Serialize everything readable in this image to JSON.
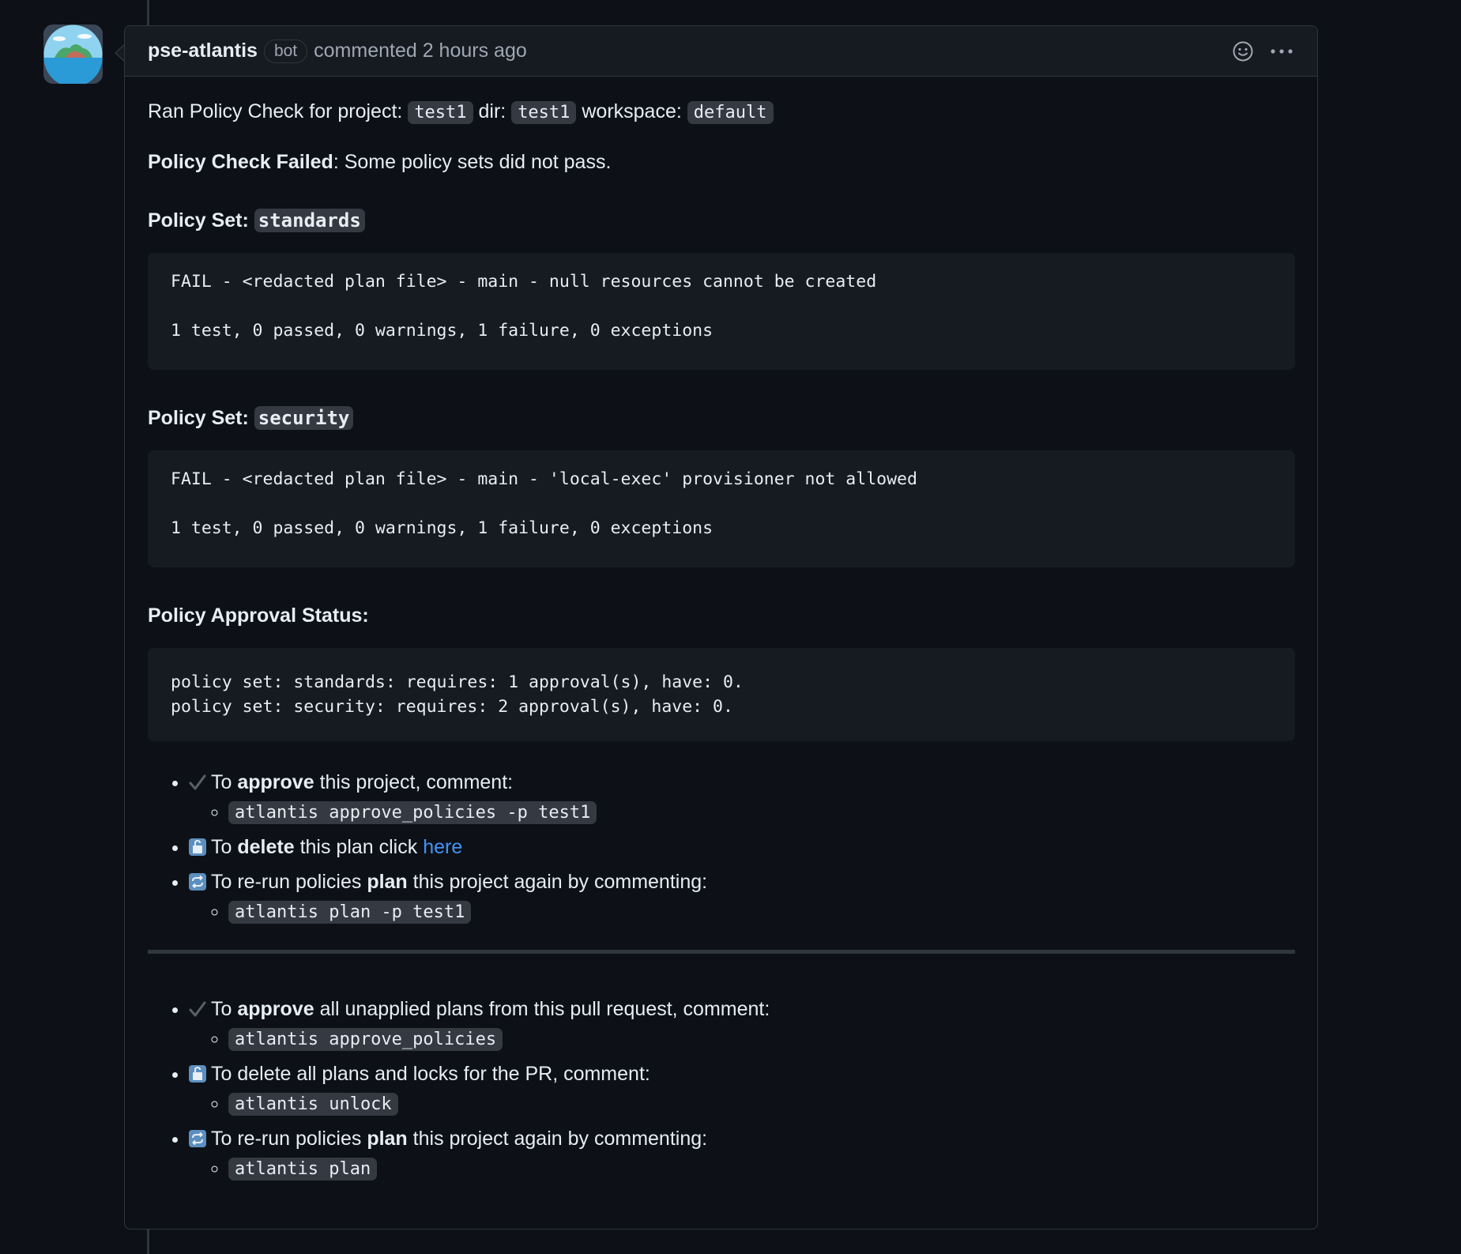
{
  "header": {
    "author": "pse-atlantis",
    "badge": "bot",
    "meta": "commented 2 hours ago"
  },
  "intro": {
    "prefix": "Ran Policy Check for project:",
    "project": "test1",
    "dir_label": "dir:",
    "dir": "test1",
    "workspace_label": "workspace:",
    "workspace": "default"
  },
  "status": {
    "bold": "Policy Check Failed",
    "text": ": Some policy sets did not pass."
  },
  "policy_sets": [
    {
      "label": "Policy Set:",
      "name": "standards",
      "output": "FAIL - <redacted plan file> - main - null resources cannot be created\n\n1 test, 0 passed, 0 warnings, 1 failure, 0 exceptions"
    },
    {
      "label": "Policy Set:",
      "name": "security",
      "output": "FAIL - <redacted plan file> - main - 'local-exec' provisioner not allowed\n\n1 test, 0 passed, 0 warnings, 1 failure, 0 exceptions"
    }
  ],
  "approval": {
    "heading": "Policy Approval Status:",
    "output": "policy set: standards: requires: 1 approval(s), have: 0.\npolicy set: security: requires: 2 approval(s), have: 0."
  },
  "project_actions": {
    "approve": {
      "pre": "To ",
      "bold": "approve",
      "post": " this project, comment:",
      "command": "atlantis approve_policies -p test1"
    },
    "delete": {
      "pre": "To ",
      "bold": "delete",
      "post": " this plan click ",
      "link": "here"
    },
    "rerun": {
      "pre": "To re-run policies ",
      "bold": "plan",
      "post": " this project again by commenting:",
      "command": "atlantis plan -p test1"
    }
  },
  "pr_actions": {
    "approve": {
      "pre": "To ",
      "bold": "approve",
      "post": " all unapplied plans from this pull request, comment:",
      "command": "atlantis approve_policies"
    },
    "unlock": {
      "text": "To delete all plans and locks for the PR, comment:",
      "command": "atlantis unlock"
    },
    "rerun": {
      "pre": "To re-run policies ",
      "bold": "plan",
      "post": " this project again by commenting:",
      "command": "atlantis plan"
    }
  },
  "icons": {
    "check": "check-mark-icon",
    "unlock": "unlock-emoji-icon",
    "repeat": "repeat-emoji-icon",
    "smiley": "smiley-icon",
    "kebab": "kebab-horizontal-icon"
  },
  "colors": {
    "background": "#0d1117",
    "header_bg": "#161b22",
    "border": "#30363d",
    "link": "#4493f8",
    "muted": "#9ea7b3"
  }
}
